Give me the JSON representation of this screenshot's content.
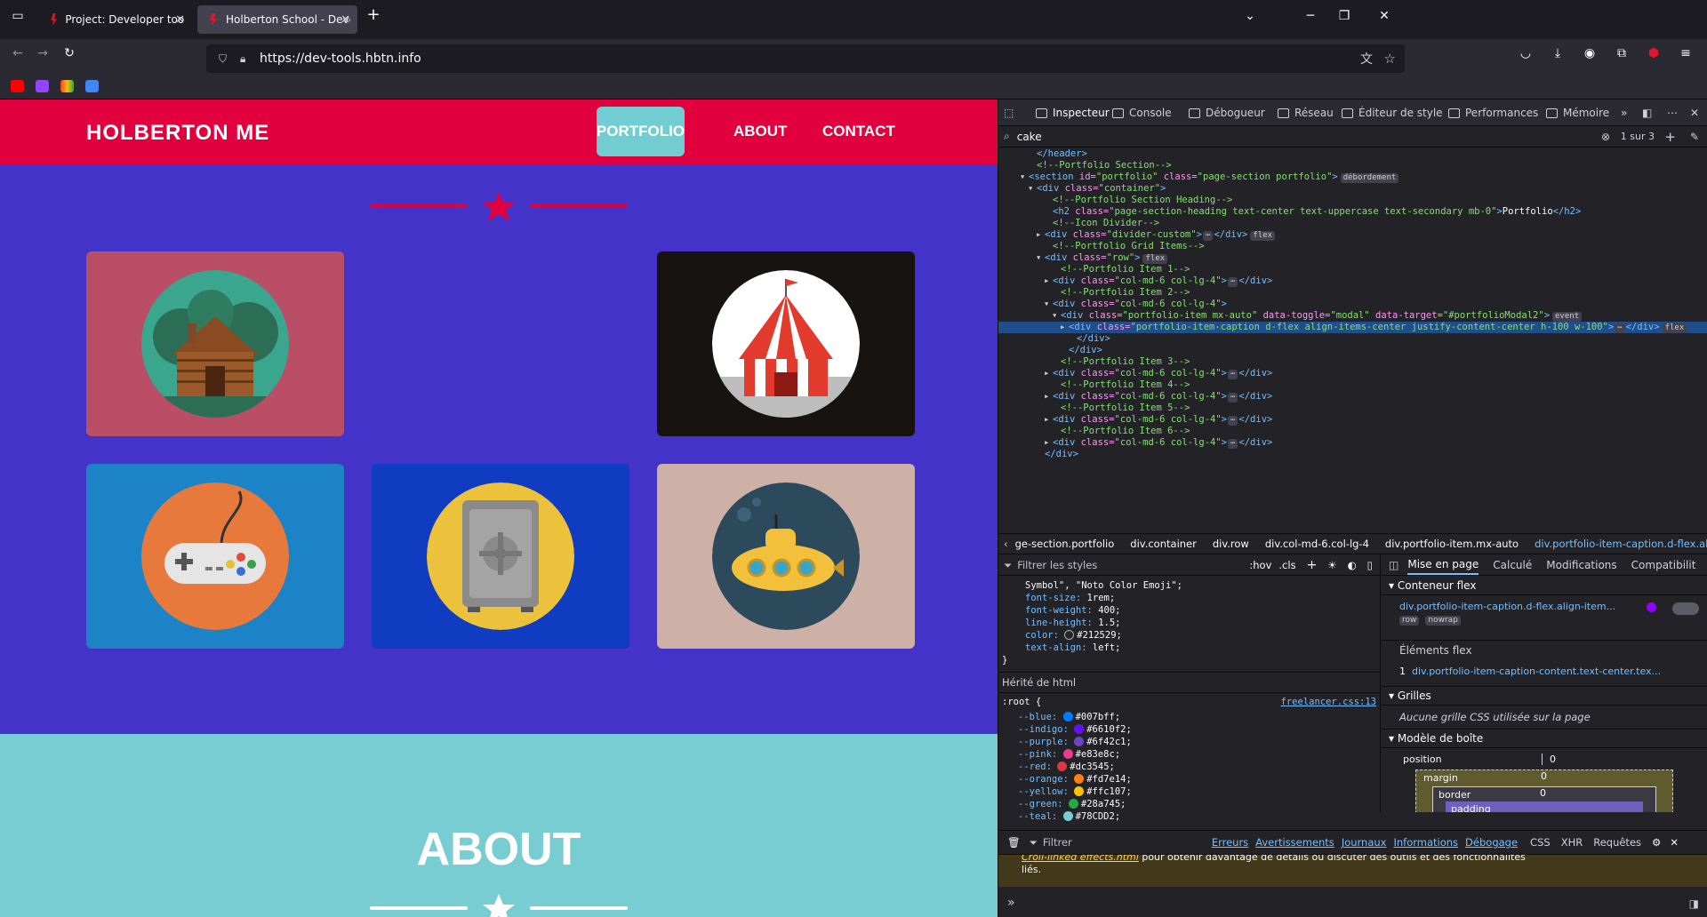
{
  "browser": {
    "tabs": [
      {
        "title": "Project: Developer tools | Holbe",
        "active": false
      },
      {
        "title": "Holberton School - Developer t",
        "active": true
      }
    ],
    "url": "https://dev-tools.hbtn.info",
    "new_tab": "+",
    "list_all_tabs": "⌄",
    "window": {
      "minimize": "─",
      "restore": "❐",
      "close": "✕"
    }
  },
  "site": {
    "brand": "HOLBERTON ME",
    "nav": [
      {
        "label": "PORTFOLIO",
        "active": true
      },
      {
        "label": "ABOUT",
        "active": false
      },
      {
        "label": "CONTACT",
        "active": false
      }
    ],
    "portfolio_items": [
      {
        "name": "cabin",
        "bg": "#b94e66",
        "circle": "#3aa68e"
      },
      {
        "name": "circus",
        "bg": "#161311",
        "circle": "#fff"
      },
      {
        "name": "game",
        "bg": "#1c84c6",
        "circle": "#e8793c"
      },
      {
        "name": "safe",
        "bg": "#0f3cc0",
        "circle": "#ecc13c"
      },
      {
        "name": "submarine",
        "bg": "#cdb0a6",
        "circle": "#2c4a5c"
      }
    ],
    "about_heading": "ABOUT"
  },
  "devtools": {
    "tabs": [
      {
        "label": "Inspecteur",
        "selected": true
      },
      {
        "label": "Console"
      },
      {
        "label": "Débogueur"
      },
      {
        "label": "Réseau"
      },
      {
        "label": "Éditeur de style"
      },
      {
        "label": "Performances"
      },
      {
        "label": "Mémoire"
      }
    ],
    "search_value": "cake",
    "search_count": "1 sur 3",
    "markup": [
      {
        "i": 3,
        "tw": "",
        "html": [
          [
            "tg",
            "</header>"
          ]
        ]
      },
      {
        "i": 3,
        "tw": "",
        "html": [
          [
            "cm",
            "<!--Portfolio Section-->"
          ]
        ]
      },
      {
        "i": 2,
        "tw": "▾",
        "html": [
          [
            "tg",
            "<section "
          ],
          [
            "at",
            "id="
          ],
          [
            "av",
            "\"portfolio\" "
          ],
          [
            "at",
            "class="
          ],
          [
            "av",
            "\"page-section portfolio\""
          ],
          [
            "tg",
            ">"
          ]
        ],
        "badge": "débordement"
      },
      {
        "i": 3,
        "tw": "▾",
        "html": [
          [
            "tg",
            "<div "
          ],
          [
            "at",
            "class="
          ],
          [
            "av",
            "\"container\""
          ],
          [
            "tg",
            ">"
          ]
        ]
      },
      {
        "i": 5,
        "tw": "",
        "html": [
          [
            "cm",
            "<!--Portfolio Section Heading-->"
          ]
        ]
      },
      {
        "i": 5,
        "tw": "",
        "html": [
          [
            "tg",
            "<h2 "
          ],
          [
            "at",
            "class="
          ],
          [
            "av",
            "\"page-section-heading text-center text-uppercase text-secondary mb-0\""
          ],
          [
            "tg",
            ">"
          ],
          [
            "",
            "Portfolio"
          ],
          [
            "tg",
            "</h2>"
          ]
        ]
      },
      {
        "i": 5,
        "tw": "",
        "html": [
          [
            "cm",
            "<!--Icon Divider-->"
          ]
        ]
      },
      {
        "i": 4,
        "tw": "▸",
        "html": [
          [
            "tg",
            "<div "
          ],
          [
            "at",
            "class="
          ],
          [
            "av",
            "\"divider-custom\""
          ],
          [
            "tg",
            ">"
          ],
          [
            "bd",
            "⋯"
          ],
          [
            "tg",
            "</div>"
          ]
        ],
        "badge": "flex"
      },
      {
        "i": 5,
        "tw": "",
        "html": [
          [
            "cm",
            "<!--Portfolio Grid Items-->"
          ]
        ]
      },
      {
        "i": 4,
        "tw": "▾",
        "html": [
          [
            "tg",
            "<div "
          ],
          [
            "at",
            "class="
          ],
          [
            "av",
            "\"row\""
          ],
          [
            "tg",
            ">"
          ]
        ],
        "badge": "flex"
      },
      {
        "i": 6,
        "tw": "",
        "html": [
          [
            "cm",
            "<!--Portfolio Item 1-->"
          ]
        ]
      },
      {
        "i": 5,
        "tw": "▸",
        "html": [
          [
            "tg",
            "<div "
          ],
          [
            "at",
            "class="
          ],
          [
            "av",
            "\"col-md-6 col-lg-4\""
          ],
          [
            "tg",
            ">"
          ],
          [
            "bd",
            "⋯"
          ],
          [
            "tg",
            "</div>"
          ]
        ]
      },
      {
        "i": 6,
        "tw": "",
        "html": [
          [
            "cm",
            "<!--Portfolio Item 2-->"
          ]
        ]
      },
      {
        "i": 5,
        "tw": "▾",
        "html": [
          [
            "tg",
            "<div "
          ],
          [
            "at",
            "class="
          ],
          [
            "av",
            "\"col-md-6 col-lg-4\""
          ],
          [
            "tg",
            ">"
          ]
        ]
      },
      {
        "i": 6,
        "tw": "▾",
        "html": [
          [
            "tg",
            "<div "
          ],
          [
            "at",
            "class="
          ],
          [
            "av",
            "\"portfolio-item mx-auto\" "
          ],
          [
            "at",
            "data-toggle="
          ],
          [
            "av",
            "\"modal\" "
          ],
          [
            "at",
            "data-target="
          ],
          [
            "av",
            "\"#portfolioModal2\""
          ],
          [
            "tg",
            ">"
          ]
        ],
        "badge": "event"
      },
      {
        "i": 7,
        "tw": "▸",
        "sel": true,
        "html": [
          [
            "tg",
            "<div "
          ],
          [
            "at",
            "class="
          ],
          [
            "av",
            "\"portfolio-item-caption d-flex align-items-center justify-content-center h-100 w-100\""
          ],
          [
            "tg",
            ">"
          ],
          [
            "bd",
            "⋯"
          ],
          [
            "tg",
            "</div>"
          ]
        ],
        "badge": "flex"
      },
      {
        "i": 8,
        "tw": "",
        "html": [
          [
            "tg",
            "</div>"
          ]
        ]
      },
      {
        "i": 7,
        "tw": "",
        "html": [
          [
            "tg",
            "</div>"
          ]
        ]
      },
      {
        "i": 6,
        "tw": "",
        "html": [
          [
            "cm",
            "<!--Portfolio Item 3-->"
          ]
        ]
      },
      {
        "i": 5,
        "tw": "▸",
        "html": [
          [
            "tg",
            "<div "
          ],
          [
            "at",
            "class="
          ],
          [
            "av",
            "\"col-md-6 col-lg-4\""
          ],
          [
            "tg",
            ">"
          ],
          [
            "bd",
            "⋯"
          ],
          [
            "tg",
            "</div>"
          ]
        ]
      },
      {
        "i": 6,
        "tw": "",
        "html": [
          [
            "cm",
            "<!--Portfolio Item 4-->"
          ]
        ]
      },
      {
        "i": 5,
        "tw": "▸",
        "html": [
          [
            "tg",
            "<div "
          ],
          [
            "at",
            "class="
          ],
          [
            "av",
            "\"col-md-6 col-lg-4\""
          ],
          [
            "tg",
            ">"
          ],
          [
            "bd",
            "⋯"
          ],
          [
            "tg",
            "</div>"
          ]
        ]
      },
      {
        "i": 6,
        "tw": "",
        "html": [
          [
            "cm",
            "<!--Portfolio Item 5-->"
          ]
        ]
      },
      {
        "i": 5,
        "tw": "▸",
        "html": [
          [
            "tg",
            "<div "
          ],
          [
            "at",
            "class="
          ],
          [
            "av",
            "\"col-md-6 col-lg-4\""
          ],
          [
            "tg",
            ">"
          ],
          [
            "bd",
            "⋯"
          ],
          [
            "tg",
            "</div>"
          ]
        ]
      },
      {
        "i": 6,
        "tw": "",
        "html": [
          [
            "cm",
            "<!--Portfolio Item 6-->"
          ]
        ]
      },
      {
        "i": 5,
        "tw": "▸",
        "html": [
          [
            "tg",
            "<div "
          ],
          [
            "at",
            "class="
          ],
          [
            "av",
            "\"col-md-6 col-lg-4\""
          ],
          [
            "tg",
            ">"
          ],
          [
            "bd",
            "⋯"
          ],
          [
            "tg",
            "</div>"
          ]
        ]
      },
      {
        "i": 4,
        "tw": "",
        "html": [
          [
            "tg",
            "</div>"
          ]
        ]
      }
    ],
    "breadcrumb": [
      "ge-section.portfolio",
      "div.container",
      "div.row",
      "div.col-md-6.col-lg-4",
      "div.portfolio-item.mx-auto",
      "div.portfolio-item-caption.d-flex.align-..."
    ],
    "rules": {
      "filter_placeholder": "Filtrer les styles",
      "hov": ":hov",
      "cls": ".cls",
      "top_props": [
        [
          "",
          "Symbol\", \"Noto Color Emoji\";"
        ],
        [
          "font-size",
          "1rem;"
        ],
        [
          "font-weight",
          "400;"
        ],
        [
          "line-height",
          "1.5;"
        ],
        [
          "color",
          "#212529;"
        ],
        [
          "text-align",
          "left;"
        ]
      ],
      "close_brace": "}",
      "inherited": "Hérité de html",
      "root_selector": ":root",
      "root_source": "freelancer.css:13",
      "vars": [
        [
          "--blue",
          "#007bff",
          "#007bff"
        ],
        [
          "--indigo",
          "#6610f2",
          "#6610f2"
        ],
        [
          "--purple",
          "#6f42c1",
          "#6f42c1"
        ],
        [
          "--pink",
          "#e83e8c",
          "#e83e8c"
        ],
        [
          "--red",
          "#dc3545",
          "#dc3545"
        ],
        [
          "--orange",
          "#fd7e14",
          "#fd7e14"
        ],
        [
          "--yellow",
          "#ffc107",
          "#ffc107"
        ],
        [
          "--green",
          "#28a745",
          "#28a745"
        ],
        [
          "--teal",
          "#78CDD2",
          "#78CDD2"
        ]
      ]
    },
    "layout": {
      "tabs": [
        "Mise en page",
        "Calculé",
        "Modifications",
        "Compatibilit"
      ],
      "flex_section": "Conteneur flex",
      "flex_selector": "div.portfolio-item-caption.d-flex.align-item...",
      "flex_badges": [
        "row",
        "nowrap"
      ],
      "flex_items_title": "Éléments flex",
      "flex_item": "div.portfolio-item-caption-content.text-center.tex...",
      "flex_item_index": "1",
      "grid_section": "Grilles",
      "grid_empty": "Aucune grille CSS utilisée sur la page",
      "box_section": "Modèle de boîte",
      "position_label": "position",
      "position_val": "0",
      "margin_label": "margin",
      "border_label": "border",
      "padding_label": "padding",
      "zero": "0"
    },
    "console": {
      "filter": "Filtrer",
      "levels": [
        "Erreurs",
        "Avertissements",
        "Journaux",
        "Informations",
        "Débogage"
      ],
      "extra": [
        "CSS",
        "XHR",
        "Requêtes"
      ],
      "msg_link": "Croll-linked effects.html",
      "msg_text": " pour obtenir davantage de détails ou discuter des outils et des fonctionnalités",
      "msg_line2": "liés.",
      "prompt": "»"
    }
  }
}
